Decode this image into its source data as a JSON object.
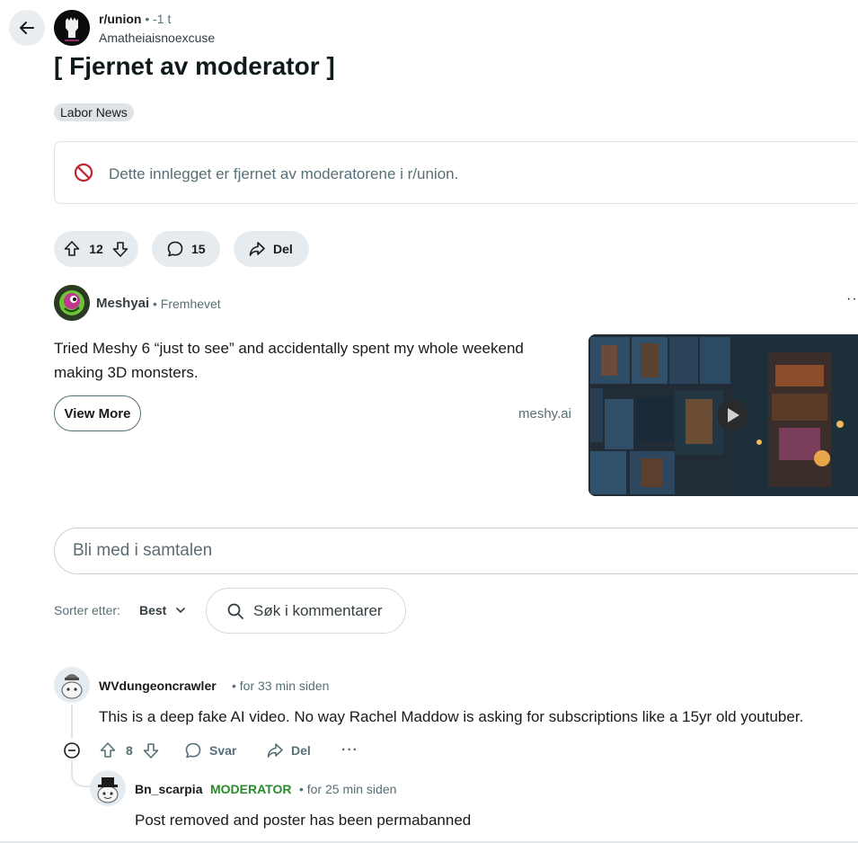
{
  "header": {
    "back_icon": "arrow-left-icon",
    "subreddit": "r/union",
    "time": " • -1 t",
    "author": "Amatheiaisnoexcuse"
  },
  "post": {
    "title": "[ Fjernet av moderator ]",
    "flair": "Labor News",
    "removed_notice": "Dette innlegget er fjernet av moderatorene i r/union.",
    "removed_icon": "prohibited-icon",
    "removed_icon_color": "#c0262e",
    "vote_count": "12",
    "comment_count": "15",
    "share_label": "Del"
  },
  "promoted": {
    "advertiser": "Meshyai",
    "promoted_label": "• Fremhevet",
    "text": "Tried Meshy 6 “just to see” and accidentally spent my whole weekend making 3D monsters.",
    "cta": "View More",
    "domain": "meshy.ai",
    "more_icon": "more-horizontal-icon",
    "play_icon": "play-icon"
  },
  "comments_section": {
    "join_placeholder": "Bli med i samtalen",
    "sort_label": "Sorter etter:",
    "sort_value": "Best",
    "search_placeholder": "Søk i kommentarer"
  },
  "comments": [
    {
      "user": "WVdungeoncrawler",
      "time": "• for 33 min siden",
      "body": "This is a deep fake AI video. No way Rachel Maddow is asking for subscriptions like a 15yr old youtuber.",
      "votes": "8",
      "reply_label": "Svar",
      "share_label": "Del",
      "more": "···"
    },
    {
      "user": "Bn_scarpia",
      "badge": "MODERATOR",
      "badge_color": "#2a8a2a",
      "time": "• for 25 min siden",
      "body": "Post removed and poster has been permabanned"
    }
  ]
}
